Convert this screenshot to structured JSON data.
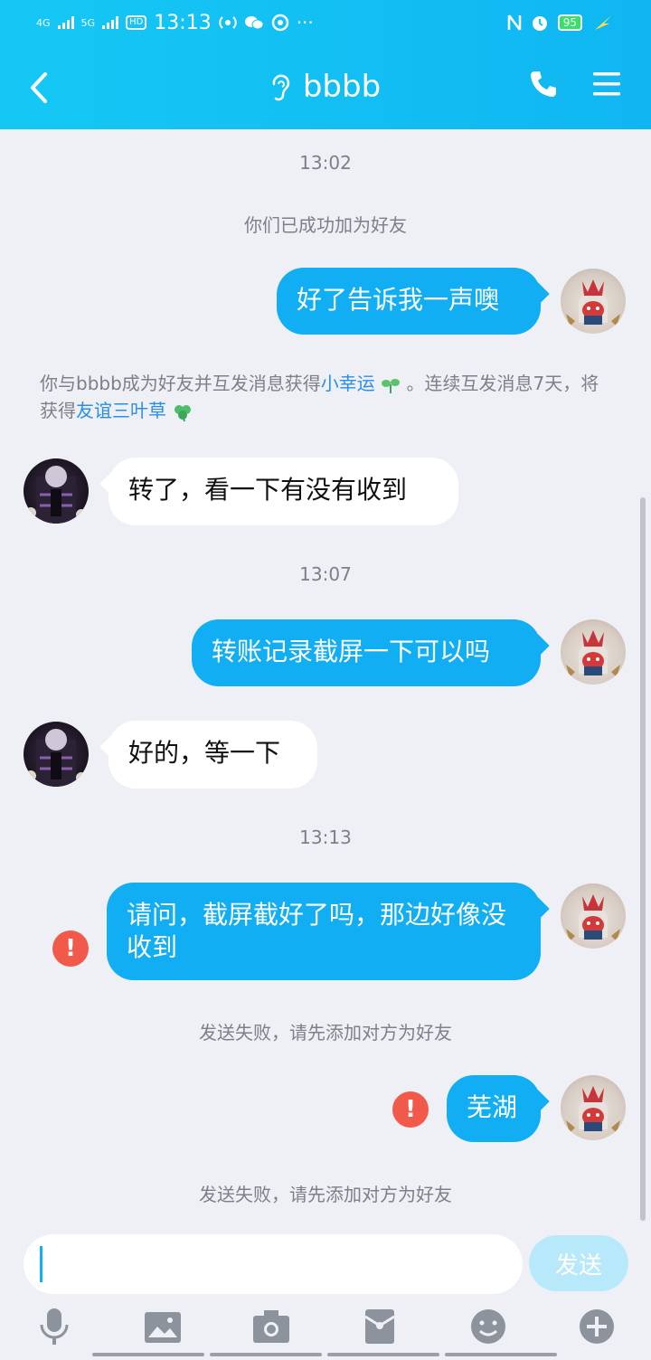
{
  "status_bar": {
    "network_1": "4G",
    "network_2": "5G",
    "hd_label": "HD",
    "time": "13:13",
    "more": "···",
    "battery": "95"
  },
  "header": {
    "title": "bbbb",
    "back_icon": "chevron-left-icon",
    "ear_icon": "ear-icon",
    "call_icon": "phone-icon",
    "menu_icon": "menu-icon"
  },
  "chat": {
    "time_1": "13:02",
    "sys_added": "你们已成功加为好友",
    "msg_1": "好了告诉我一声噢",
    "sys_luck_1": "你与bbbb成为好友并互发消息获得",
    "sys_luck_link_1": "小幸运",
    "sys_luck_2": "。连续互发消息7天，将获得",
    "sys_luck_link_2": "友谊三叶草",
    "msg_2": "转了，看一下有没有收到",
    "time_2": "13:07",
    "msg_3": "转账记录截屏一下可以吗",
    "msg_4": "好的，等一下",
    "time_3": "13:13",
    "msg_5": "请问，截屏截好了吗，那边好像没收到",
    "sys_fail_1": "发送失败，请先添加对方为好友",
    "msg_6": "芜湖",
    "sys_fail_2": "发送失败，请先添加对方为好友",
    "error_mark": "!"
  },
  "input": {
    "send_label": "发送",
    "tools": [
      "microphone-icon",
      "image-icon",
      "camera-icon",
      "red-packet-icon",
      "emoji-icon",
      "plus-icon"
    ]
  },
  "colors": {
    "accent": "#12aef4",
    "header": "#15c8f4",
    "error": "#f15a4a",
    "background": "#eef0f5"
  }
}
